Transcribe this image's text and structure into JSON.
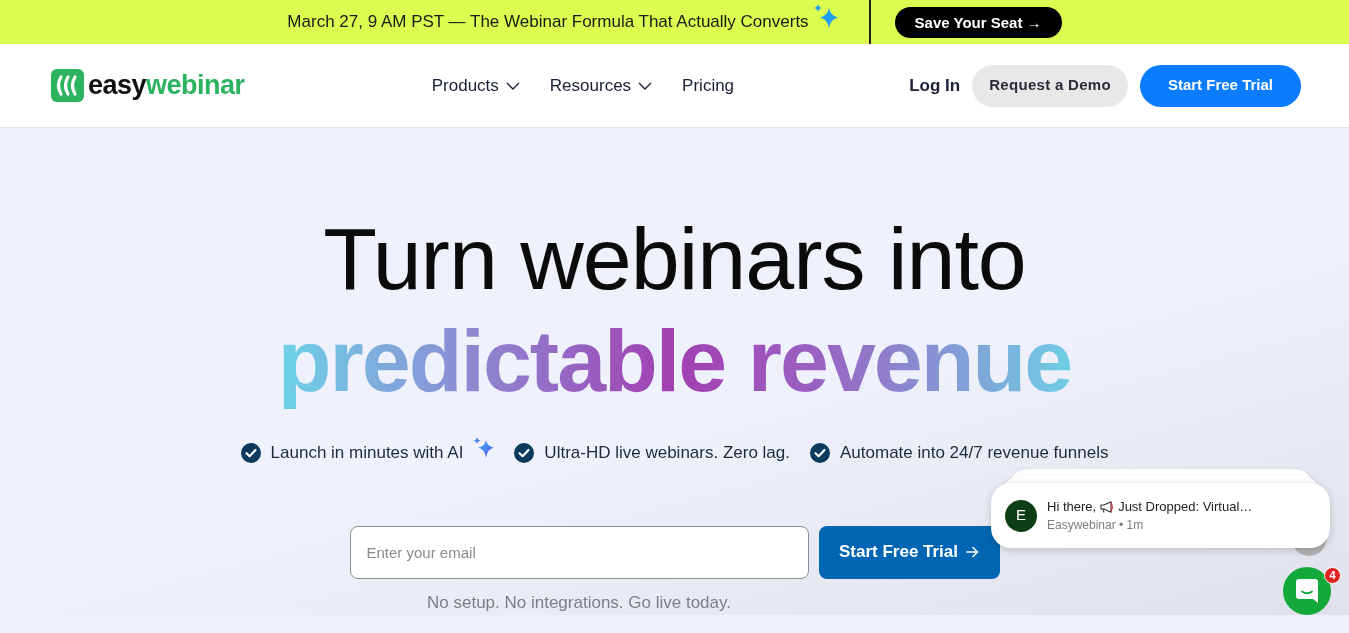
{
  "announcement": {
    "text": "March 27, 9 AM PST — The Webinar Formula That Actually Converts",
    "button": "Save Your Seat →"
  },
  "navbar": {
    "logo": {
      "part_1": "easy",
      "part_2": "webinar"
    },
    "menu": [
      {
        "label": "Products",
        "dropdown": true
      },
      {
        "label": "Resources",
        "dropdown": true
      },
      {
        "label": "Pricing",
        "dropdown": false
      }
    ],
    "login": "Log In",
    "demo_button": "Request a Demo",
    "trial_button": "Start Free Trial"
  },
  "hero": {
    "heading_line_1": "Turn webinars into",
    "heading_line_2": "predictable revenue",
    "features": [
      {
        "text": "Launch in minutes with AI",
        "sparkle": true
      },
      {
        "text": "Ultra-HD live webinars. Zero lag.",
        "sparkle": false
      },
      {
        "text": "Automate into 24/7 revenue funnels",
        "sparkle": false
      }
    ],
    "email": {
      "placeholder": "Enter your email"
    },
    "cta": "Start Free Trial",
    "note": "No setup. No integrations. Go live today."
  },
  "chat": {
    "message": {
      "avatar": "E",
      "greeting": "Hi there,",
      "text": "Just Dropped: Virtual…",
      "meta": "Easywebinar • 1m"
    },
    "badge": "4"
  }
}
